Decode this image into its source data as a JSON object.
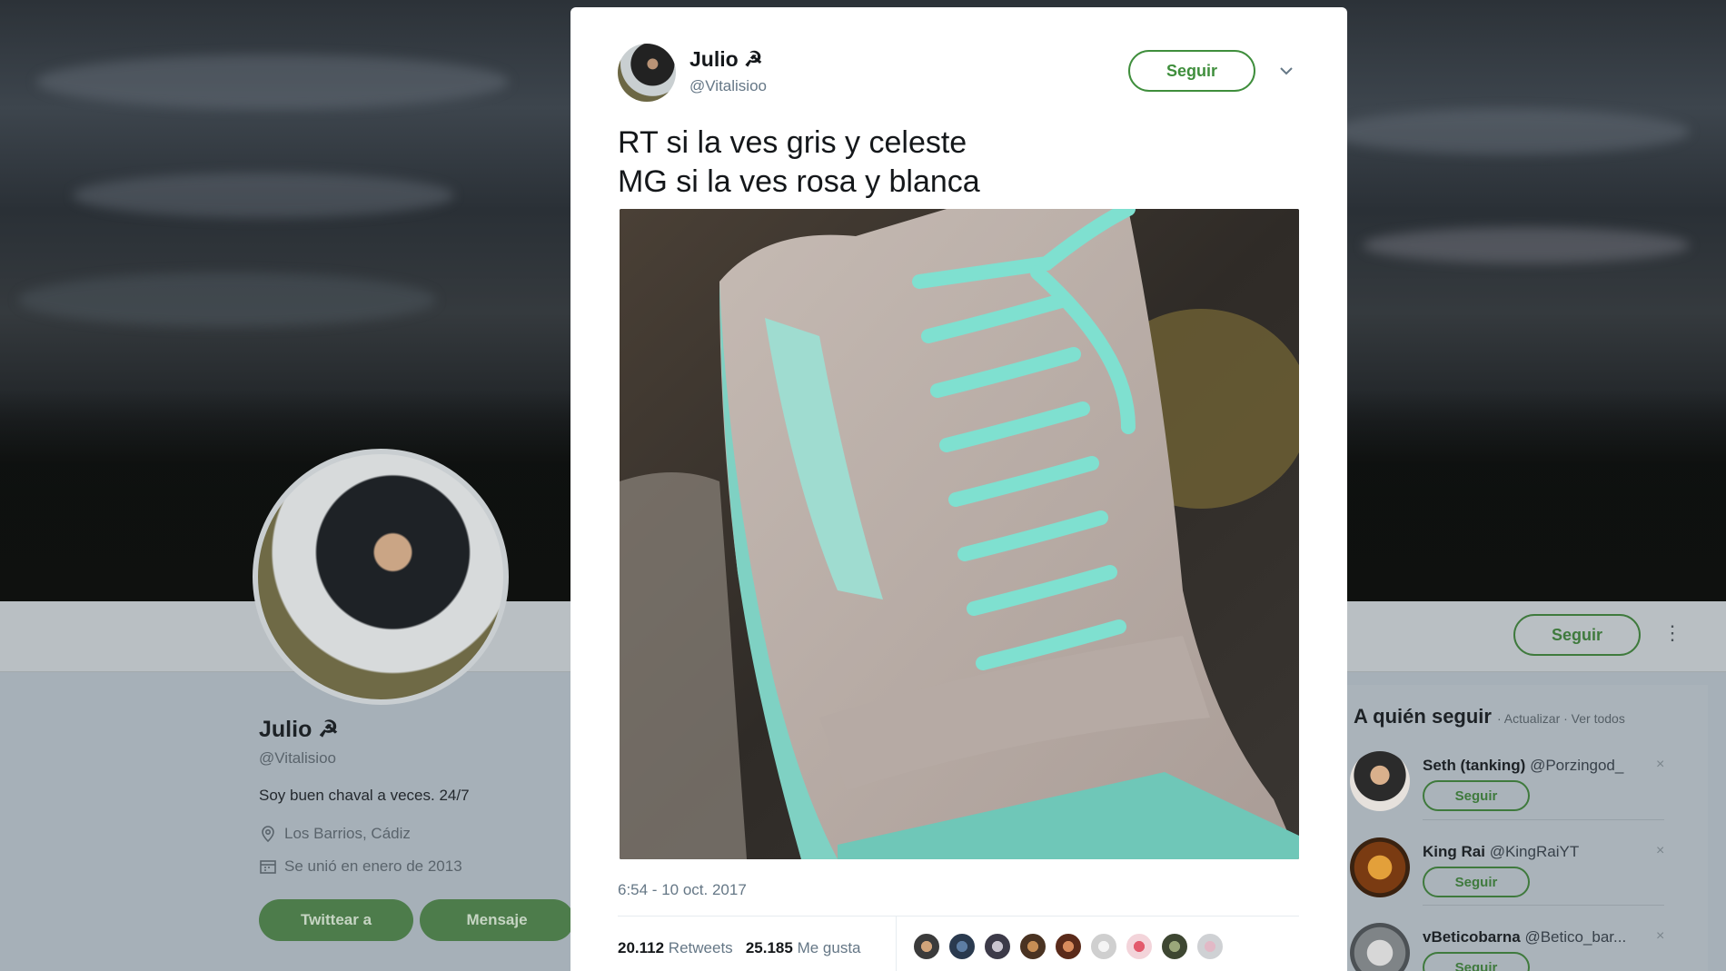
{
  "profile": {
    "name": "Julio ☭",
    "handle": "@Vitalisioo",
    "bio": "Soy buen chaval a veces. 24/7",
    "location": "Los Barrios, Cádiz",
    "joined": "Se unió en enero de 2013",
    "tweet_to_label": "Twittear a",
    "message_label": "Mensaje",
    "follow_label": "Seguir"
  },
  "who_to_follow": {
    "title": "A quién seguir",
    "actions": "· Actualizar · Ver todos",
    "users": [
      {
        "name": "Seth (tanking)",
        "handle": "@Porzingod_",
        "follow_label": "Seguir",
        "close": "×"
      },
      {
        "name": "King Rai",
        "handle": "@KingRaiYT",
        "follow_label": "Seguir",
        "close": "×"
      },
      {
        "name": "vBeticobarna",
        "handle": "@Betico_bar...",
        "follow_label": "Seguir",
        "close": "×"
      }
    ]
  },
  "tweet": {
    "author_name": "Julio ☭",
    "author_handle": "@Vitalisioo",
    "follow_label": "Seguir",
    "text": "RT si la ves gris y celeste\nMG si la ves rosa y blanca",
    "timestamp": "6:54 - 10 oct. 2017",
    "retweets_count": "20.112",
    "retweets_label": "Retweets",
    "likes_count": "25.185",
    "likes_label": "Me gusta"
  },
  "colors": {
    "accent_green": "#3f8e3c",
    "dim_green_button": "#4d7c4b",
    "text_primary": "#14171a",
    "text_secondary": "#657786"
  }
}
